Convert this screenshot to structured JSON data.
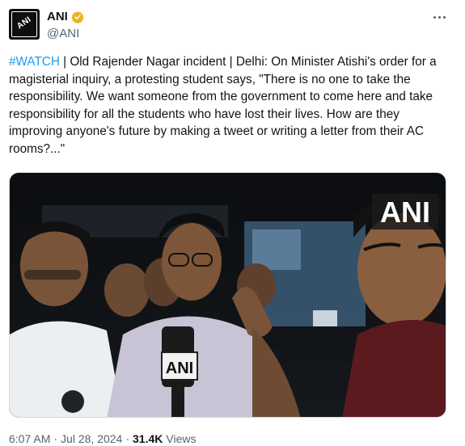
{
  "author": {
    "name": "ANI",
    "handle": "@ANI",
    "avatar_text": "ANI",
    "verified_color": "#e8b423"
  },
  "menu_icon": "more-horizontal-icon",
  "tweet": {
    "hashtag": "#WATCH",
    "body": " | Old Rajender Nagar incident | Delhi: On Minister Atishi's order for a magisterial inquiry, a protesting student says, \"There is no one to take the responsibility. We want someone from the government to come here and take responsibility for all the students who have lost their lives. How are they improving anyone's future by making a tweet or writing a letter from their AC rooms?...\""
  },
  "media": {
    "watermark": "ANI",
    "mic_label": "ANI"
  },
  "meta": {
    "time": "6:07 AM",
    "separator1": "·",
    "date": "Jul 28, 2024",
    "separator2": "·",
    "views_count": "31.4K",
    "views_label": "Views"
  },
  "colors": {
    "link": "#1d9bf0",
    "secondary_text": "#536471",
    "primary_text": "#0f1419"
  }
}
